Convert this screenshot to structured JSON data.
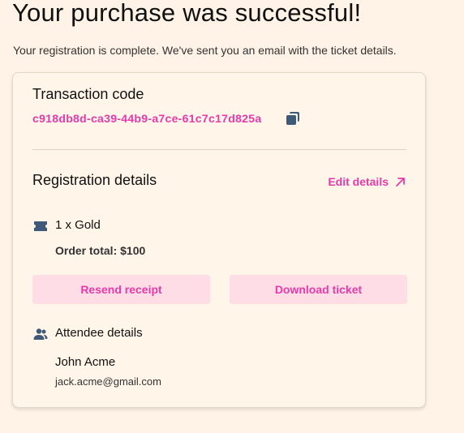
{
  "header": {
    "title": "Your purchase was successful!",
    "subtitle": "Your registration is complete. We've sent you an email with the ticket details."
  },
  "transaction": {
    "label": "Transaction code",
    "code": "c918db8d-ca39-44b9-a7ce-61c7c17d825a",
    "copy_icon": "copy-icon"
  },
  "registration": {
    "label": "Registration details",
    "edit_label": "Edit details",
    "edit_icon": "arrow-up-right-icon",
    "ticket": {
      "icon": "ticket-icon",
      "label": "1 x Gold",
      "order_total": "Order total: $100"
    },
    "actions": {
      "resend_label": "Resend receipt",
      "download_label": "Download ticket"
    }
  },
  "attendee": {
    "icon": "users-icon",
    "label": "Attendee details",
    "name": "John Acme",
    "email": "jack.acme@gmail.com"
  },
  "colors": {
    "background": "#fef3e6",
    "accent": "#e83aa9",
    "button_bg": "#ffdde6",
    "icon": "#3f5a78"
  }
}
